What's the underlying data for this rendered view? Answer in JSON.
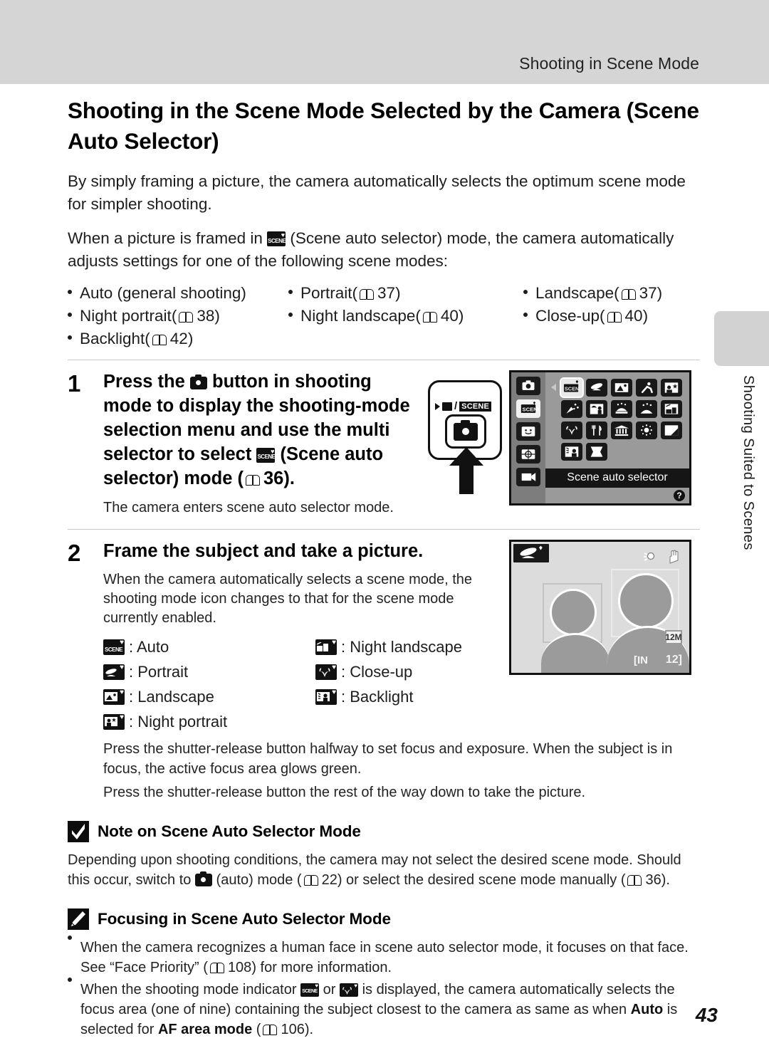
{
  "header": {
    "running_title": "Shooting in Scene Mode"
  },
  "side_tab": {
    "label": "Shooting Suited to Scenes"
  },
  "page": {
    "number": "43",
    "title": "Shooting in the Scene Mode Selected by the Camera (Scene Auto Selector)",
    "intro_1": "By simply framing a picture, the camera automatically selects the optimum scene mode for simpler shooting.",
    "intro_2_part1": "When a picture is framed in",
    "intro_2_part2": "(Scene auto selector) mode, the camera automatically adjusts settings for one of the following scene modes:"
  },
  "mode_list": [
    {
      "label": "Auto (general shooting)",
      "ref": ""
    },
    {
      "label": "Portrait",
      "ref": "37"
    },
    {
      "label": "Landscape",
      "ref": "37"
    },
    {
      "label": "Night portrait",
      "ref": "38"
    },
    {
      "label": "Night landscape",
      "ref": "40"
    },
    {
      "label": "Close-up",
      "ref": "40"
    },
    {
      "label": "Backlight",
      "ref": "42"
    }
  ],
  "step1": {
    "number": "1",
    "title_a": "Press the",
    "title_b": "button in shooting mode to display the shooting-mode selection menu and use the multi selector to select",
    "title_c": "(Scene auto selector) mode (",
    "title_ref": "36",
    "title_d": ").",
    "sub": "The camera enters scene auto selector mode.",
    "button_art": {
      "movie_scene_label": "SCENE",
      "slash": "/"
    },
    "lcd": {
      "selected_label": "Scene auto selector",
      "help_glyph": "?",
      "sidebar_icons": [
        "camera-auto-icon",
        "scene-auto-selector-icon",
        "smart-portrait-icon",
        "subject-tracking-icon",
        "movie-icon"
      ],
      "grid_icons": [
        "scene-auto-selector",
        "portrait",
        "landscape",
        "sports",
        "night-portrait",
        "party-indoor",
        "beach",
        "snow",
        "sunset",
        "dusk-dawn",
        "close-up",
        "food",
        "museum",
        "fireworks",
        "copy",
        "backlight",
        "panorama-assist"
      ]
    }
  },
  "step2": {
    "number": "2",
    "title": "Frame the subject and take a picture.",
    "sub": "When the camera automatically selects a scene mode, the shooting mode icon changes to that for the scene mode currently enabled.",
    "legend_left": [
      {
        "icon": "scene-auto-icon",
        "label": ": Auto"
      },
      {
        "icon": "portrait-icon",
        "label": ": Portrait"
      },
      {
        "icon": "landscape-icon",
        "label": ": Landscape"
      },
      {
        "icon": "night-portrait-icon",
        "label": ": Night portrait"
      }
    ],
    "legend_right": [
      {
        "icon": "night-landscape-icon",
        "label": ": Night landscape"
      },
      {
        "icon": "close-up-icon",
        "label": ": Close-up"
      },
      {
        "icon": "backlight-icon",
        "label": ": Backlight"
      }
    ],
    "para_1": "Press the shutter-release button halfway to set focus and exposure. When the subject is in focus, the active focus area glows green.",
    "para_2": "Press the shutter-release button the rest of the way down to take the picture.",
    "live_view": {
      "mode_icon": "portrait-mode-icon",
      "image_size": "12M",
      "memory": "IN",
      "shots_remaining": "12"
    }
  },
  "note_1": {
    "icon": "caution-check-icon",
    "title": "Note on Scene Auto Selector Mode",
    "text_a": "Depending upon shooting conditions, the camera may not select the desired scene mode. Should this occur, switch to",
    "text_b": "(auto) mode (",
    "ref_1": "22",
    "text_c": ") or select the desired scene mode manually (",
    "ref_2": "36",
    "text_d": ")."
  },
  "note_2": {
    "icon": "pencil-note-icon",
    "title": "Focusing in Scene Auto Selector Mode",
    "bullets": [
      {
        "text_a": "When the camera recognizes a human face in scene auto selector mode, it focuses on that face. See “Face Priority” (",
        "ref": "108",
        "text_b": ") for more information."
      },
      {
        "text_a": "When the shooting mode indicator",
        "text_or": "or",
        "text_b": "is displayed, the camera automatically selects the focus area (one of nine) containing the subject closest to the camera as same as when",
        "bold_1": "Auto",
        "text_c": "is selected for",
        "bold_2": "AF area mode",
        "text_d": "(",
        "ref": "106",
        "text_e": ")."
      }
    ]
  }
}
